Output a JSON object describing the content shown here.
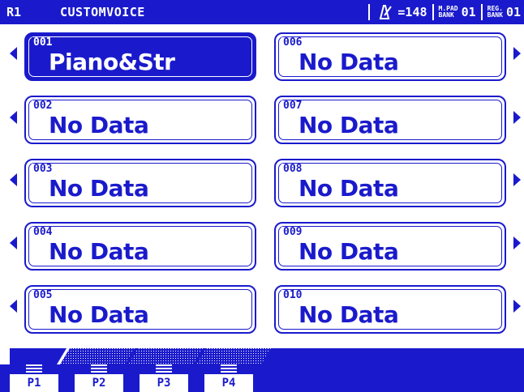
{
  "header": {
    "position": "R1",
    "title": "CUSTOMVOICE",
    "tempo": "=148",
    "mpad_top": "M.PAD",
    "mpad_bottom": "BANK",
    "mpad_value": "01",
    "reg_top": "REG.",
    "reg_bottom": "BANK",
    "reg_value": "01"
  },
  "slots": [
    {
      "num": "001",
      "name": "Piano&Str",
      "selected": true
    },
    {
      "num": "002",
      "name": "No Data"
    },
    {
      "num": "003",
      "name": "No Data"
    },
    {
      "num": "004",
      "name": "No Data"
    },
    {
      "num": "005",
      "name": "No Data"
    },
    {
      "num": "006",
      "name": "No Data"
    },
    {
      "num": "007",
      "name": "No Data"
    },
    {
      "num": "008",
      "name": "No Data"
    },
    {
      "num": "009",
      "name": "No Data"
    },
    {
      "num": "010",
      "name": "No Data"
    }
  ],
  "tabs": [
    {
      "label": "P1",
      "active": true
    },
    {
      "label": "P2"
    },
    {
      "label": "P3"
    },
    {
      "label": "P4"
    }
  ],
  "colors": {
    "accent": "#1a1acc",
    "background": "#ffffff"
  }
}
